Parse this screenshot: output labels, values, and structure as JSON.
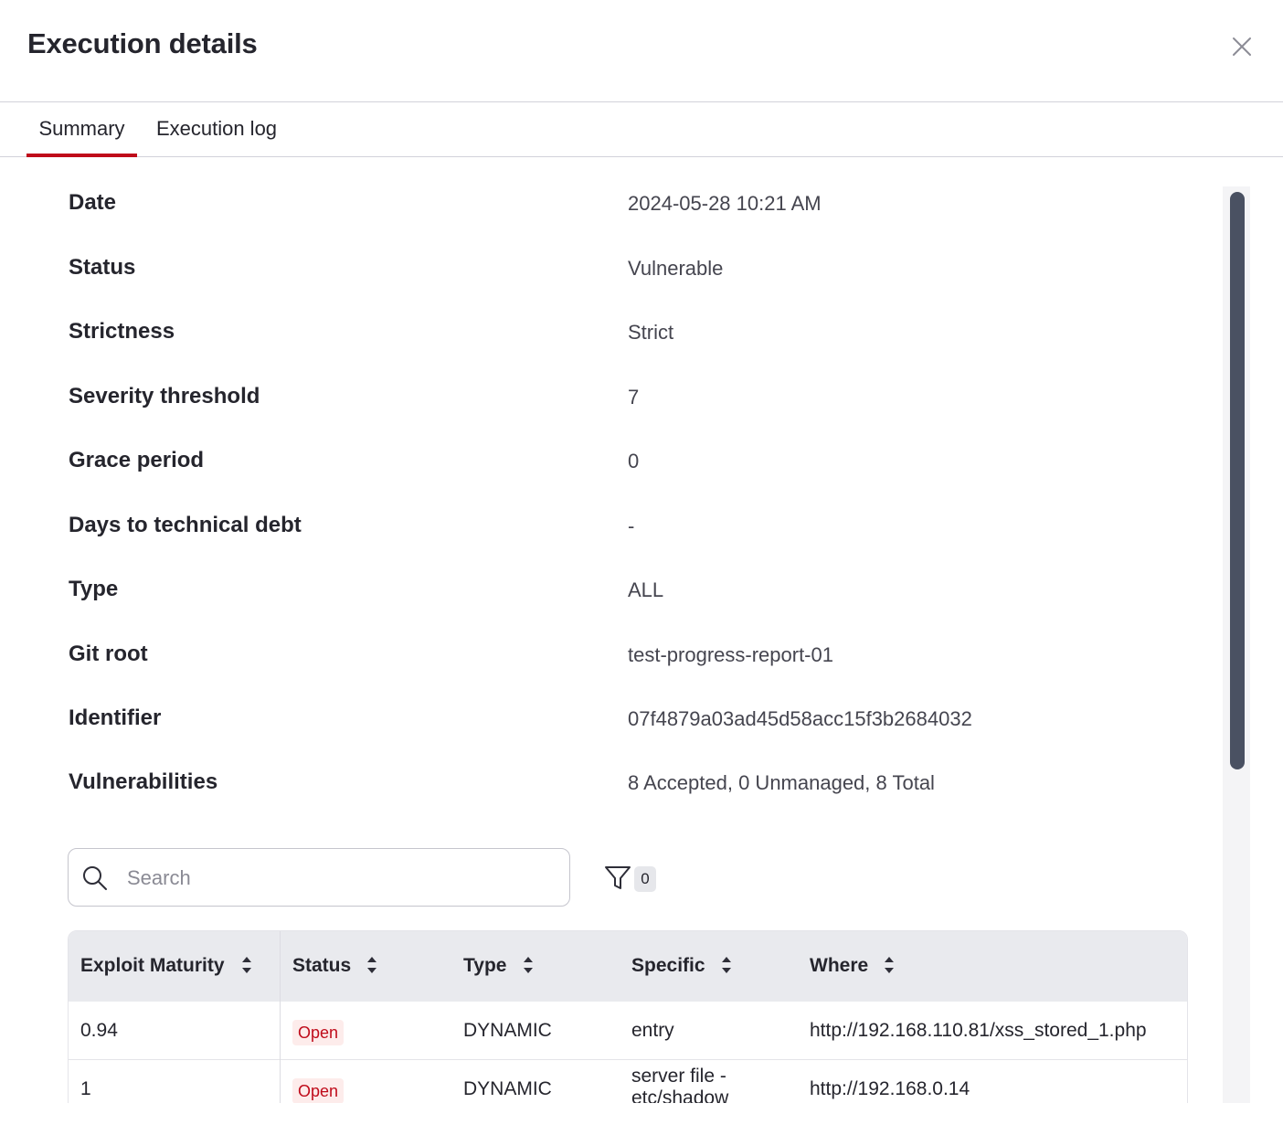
{
  "modal": {
    "title": "Execution details"
  },
  "tabs": [
    {
      "label": "Summary",
      "active": true
    },
    {
      "label": "Execution log",
      "active": false
    }
  ],
  "details": [
    {
      "label": "Date",
      "value": "2024-05-28 10:21 AM"
    },
    {
      "label": "Status",
      "value": "Vulnerable"
    },
    {
      "label": "Strictness",
      "value": "Strict"
    },
    {
      "label": "Severity threshold",
      "value": "7"
    },
    {
      "label": "Grace period",
      "value": "0"
    },
    {
      "label": "Days to technical debt",
      "value": "-"
    },
    {
      "label": "Type",
      "value": "ALL"
    },
    {
      "label": "Git root",
      "value": "test-progress-report-01"
    },
    {
      "label": "Identifier",
      "value": "07f4879a03ad45d58acc15f3b2684032"
    },
    {
      "label": "Vulnerabilities",
      "value": "8 Accepted, 0 Unmanaged, 8 Total"
    }
  ],
  "search": {
    "placeholder": "Search",
    "value": ""
  },
  "filter": {
    "count": "0"
  },
  "table": {
    "columns": [
      "Exploit Maturity",
      "Status",
      "Type",
      "Specific",
      "Where"
    ],
    "rows": [
      {
        "exploit_maturity": "0.94",
        "status": "Open",
        "type": "DYNAMIC",
        "specific": "entry",
        "where": "http://192.168.110.81/xss_stored_1.php"
      },
      {
        "exploit_maturity": "1",
        "status": "Open",
        "type": "DYNAMIC",
        "specific": "server file - etc/shadow",
        "where": "http://192.168.0.14"
      }
    ]
  },
  "colors": {
    "accent": "#bf0b1a",
    "scrollbar_thumb": "#4a5162",
    "badge_bg": "#fdeceb"
  },
  "icons": {
    "close": "close-icon",
    "search": "search-icon",
    "filter": "filter-icon",
    "sort": "sort-icon"
  }
}
